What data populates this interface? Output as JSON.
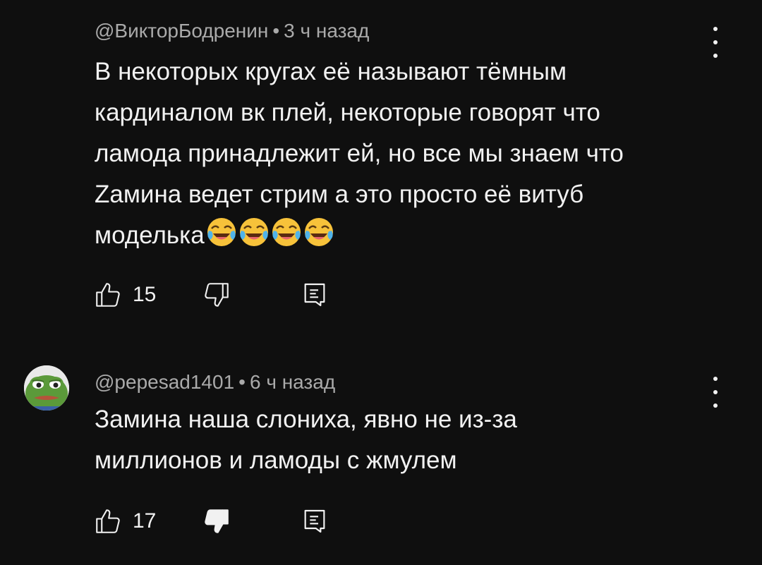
{
  "comments": [
    {
      "author": "@ВикторБодренин",
      "separator": "•",
      "time": "3 ч назад",
      "text_lines": [
        "В некоторых кругах её называют тёмным",
        "кардиналом вк плей, некоторые говорят что",
        "ламода принадлежит ей, но все мы знаем что",
        "Zамина ведет стрим  а это просто её витуб",
        "моделька"
      ],
      "emoji": [
        "face-with-tears-of-joy",
        "face-with-tears-of-joy",
        "face-with-tears-of-joy",
        "face-with-tears-of-joy"
      ],
      "likes": "15",
      "dislike_state": "outline",
      "has_avatar": false
    },
    {
      "author": "@pepesad1401",
      "separator": "•",
      "time": "6 ч назад",
      "text_lines": [
        "Замина наша слониха, явно не из-за",
        "миллионов и ламоды с жмулем"
      ],
      "likes": "17",
      "dislike_state": "filled",
      "has_avatar": true,
      "avatar": "pepe-frog-avatar"
    }
  ],
  "icons": {
    "like": "thumbs-up-icon",
    "dislike": "thumbs-down-icon",
    "reply": "reply-comment-icon",
    "menu": "more-vertical-icon"
  },
  "colors": {
    "background": "#0f0f0f",
    "text": "#f1f1f1",
    "meta": "#aaaaaa"
  }
}
